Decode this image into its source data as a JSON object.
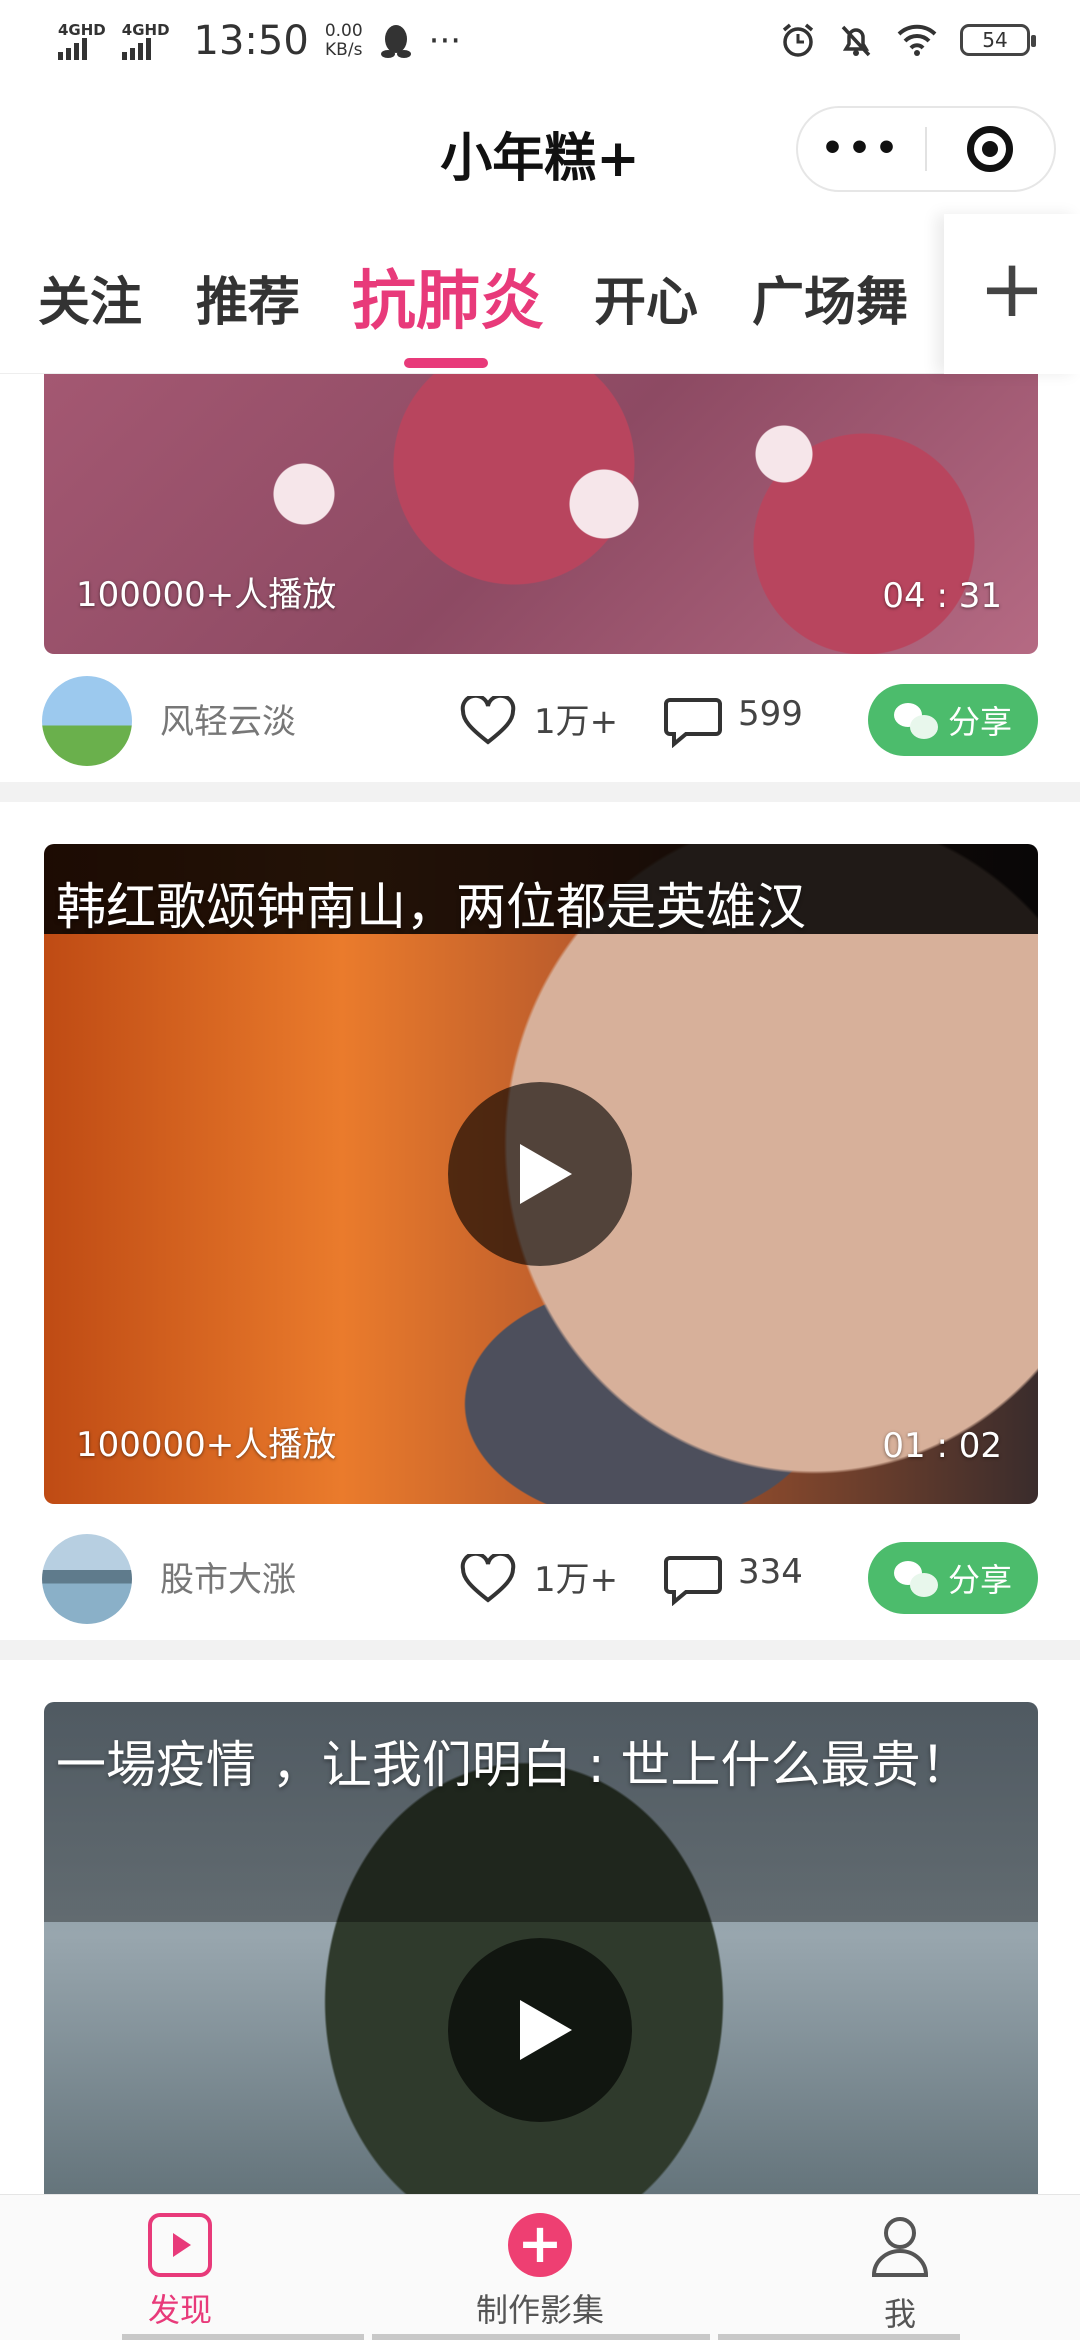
{
  "status_bar": {
    "network_1": "4GHD",
    "network_2": "4GHD",
    "time": "13:50",
    "speed_value": "0.00",
    "speed_unit": "KB/s",
    "more": "···",
    "battery": "54"
  },
  "header": {
    "title": "小年糕+",
    "capsule_more": "•••"
  },
  "tabs": {
    "items": [
      {
        "label": "关注"
      },
      {
        "label": "推荐"
      },
      {
        "label": "抗肺炎"
      },
      {
        "label": "开心"
      },
      {
        "label": "广场舞"
      }
    ],
    "active_index": 2,
    "add_label": "+"
  },
  "feed": {
    "items": [
      {
        "caption": "",
        "play_count": "100000+人播放",
        "duration": "04 : 31",
        "author": "风轻云淡",
        "likes": "1万+",
        "comments": "599",
        "share_label": "分享"
      },
      {
        "caption": "韩红歌颂钟南山，两位都是英雄汉",
        "play_count": "100000+人播放",
        "duration": "01 : 02",
        "author": "股市大涨",
        "likes": "1万+",
        "comments": "334",
        "share_label": "分享"
      },
      {
        "caption": "一場疫情 ，让我们明白 : 世上什么最贵！"
      }
    ]
  },
  "bottom_nav": {
    "items": [
      {
        "label": "发现",
        "icon": "play-square-icon",
        "active": true
      },
      {
        "label": "制作影集",
        "icon": "plus-circle-icon",
        "active": false
      },
      {
        "label": "我",
        "icon": "person-icon",
        "active": false
      }
    ]
  },
  "colors": {
    "accent": "#e83a7a",
    "share_green": "#4cbc6c"
  }
}
